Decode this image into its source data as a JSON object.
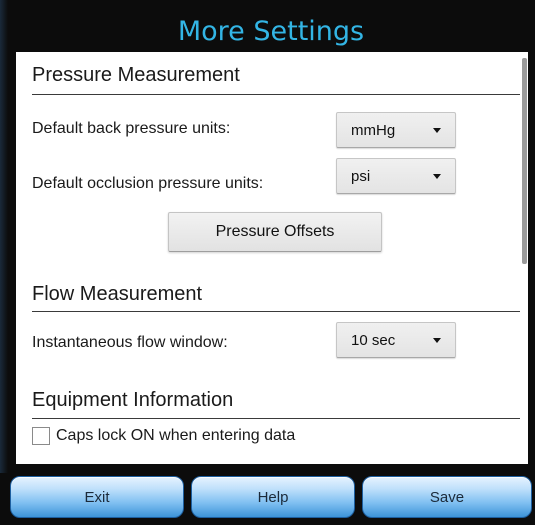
{
  "dialog": {
    "title": "More Settings"
  },
  "sections": {
    "pressure": {
      "header": "Pressure Measurement",
      "back_pressure_label": "Default back pressure units:",
      "back_pressure_value": "mmHg",
      "occlusion_label": "Default occlusion pressure units:",
      "occlusion_value": "psi",
      "offsets_button": "Pressure Offsets"
    },
    "flow": {
      "header": "Flow Measurement",
      "window_label": "Instantaneous flow window:",
      "window_value": "10 sec"
    },
    "equipment": {
      "header": "Equipment Information",
      "caps_lock_label": "Caps lock ON when entering data",
      "caps_lock_checked": false
    }
  },
  "footer": {
    "exit_label": "Exit",
    "help_label": "Help",
    "save_label": "Save"
  },
  "colors": {
    "title": "#33b5e5",
    "background": "#0c0c0c",
    "panel": "#ffffff",
    "button_gradient_bottom": "#3d93d8"
  }
}
